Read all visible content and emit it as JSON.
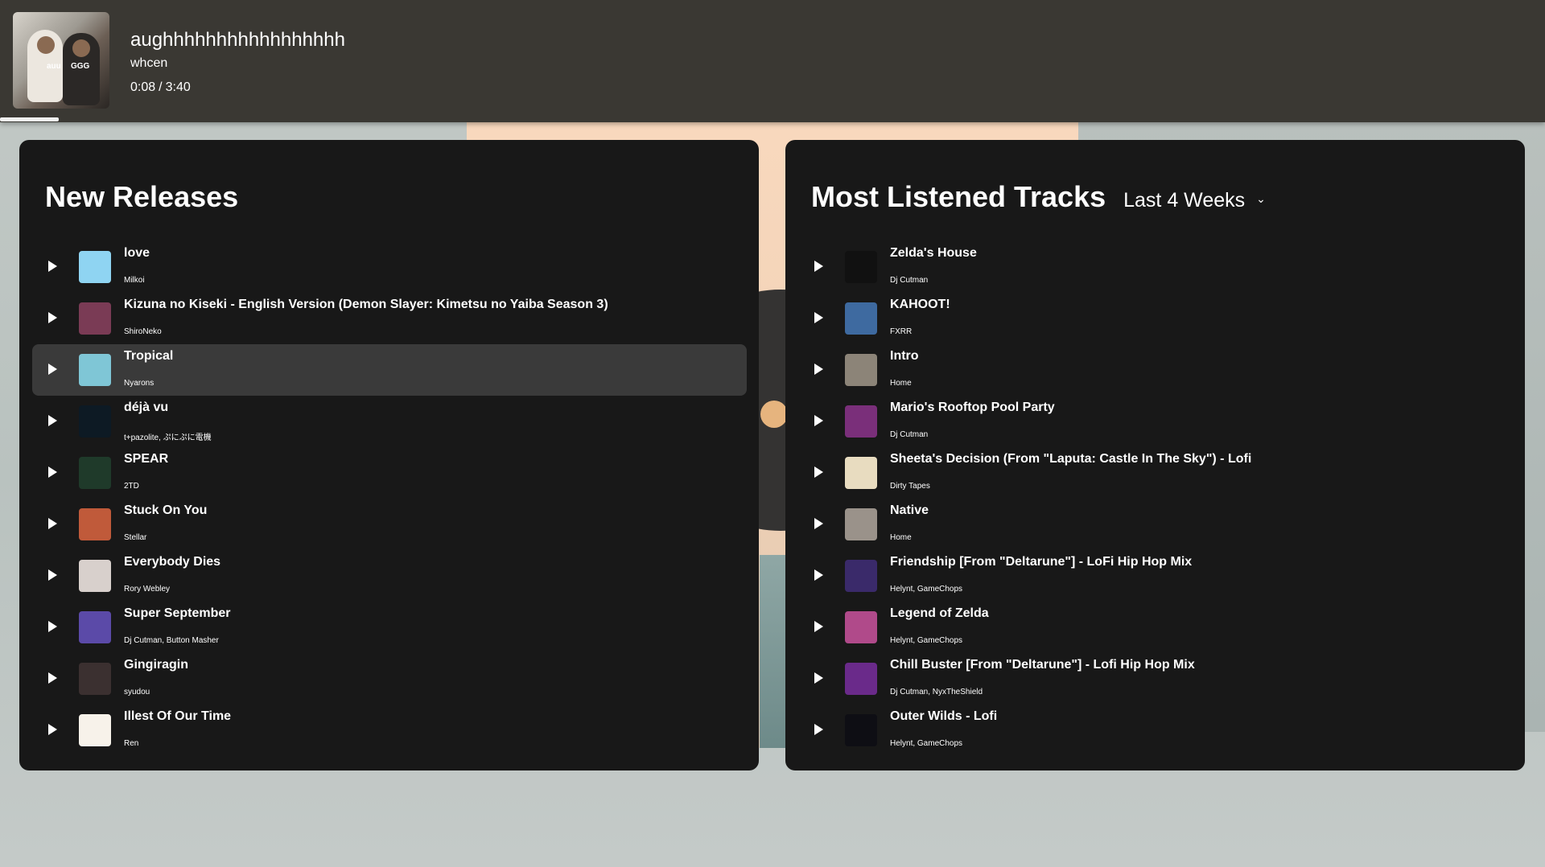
{
  "now_playing": {
    "title": "aughhhhhhhhhhhhhhhhh",
    "artist": "whcen",
    "elapsed": "0:08",
    "duration": "3:40",
    "progress": 0.038,
    "cover_text_left": "auu",
    "cover_text_right": "GGG"
  },
  "new_releases": {
    "title": "New Releases",
    "tracks": [
      {
        "name": "love",
        "artist": "Milkoi",
        "art_color": "#8fd4f2"
      },
      {
        "name": "Kizuna no Kiseki - English Version (Demon Slayer: Kimetsu no Yaiba Season 3)",
        "artist": "ShiroNeko",
        "art_color": "#7a3b55"
      },
      {
        "name": "Tropical",
        "artist": "Nyarons",
        "art_color": "#7fc6d6"
      },
      {
        "name": "déjà vu",
        "artist": "t+pazolite, ぷにぷに電機",
        "art_color": "#0d1a24"
      },
      {
        "name": "SPEAR",
        "artist": "2TD",
        "art_color": "#1f3a2a"
      },
      {
        "name": "Stuck On You",
        "artist": "Stellar",
        "art_color": "#c05a3a"
      },
      {
        "name": "Everybody Dies",
        "artist": "Rory Webley",
        "art_color": "#d8d0cc"
      },
      {
        "name": "Super September",
        "artist": "Dj Cutman, Button Masher",
        "art_color": "#5b4aa8"
      },
      {
        "name": "Gingiragin",
        "artist": "syudou",
        "art_color": "#3b3030"
      },
      {
        "name": "Illest Of Our Time",
        "artist": "Ren",
        "art_color": "#f7f2ea"
      }
    ]
  },
  "most_listened": {
    "title": "Most Listened Tracks",
    "range_label": "Last 4 Weeks",
    "tracks": [
      {
        "name": "Zelda's House",
        "artist": "Dj Cutman",
        "art_color": "#111111"
      },
      {
        "name": "KAHOOT!",
        "artist": "FXRR",
        "art_color": "#3e6aa0"
      },
      {
        "name": "Intro",
        "artist": "Home",
        "art_color": "#8c8478"
      },
      {
        "name": "Mario's Rooftop Pool Party",
        "artist": "Dj Cutman",
        "art_color": "#7a2f7a"
      },
      {
        "name": "Sheeta's Decision (From \"Laputa: Castle In The Sky\") - Lofi",
        "artist": "Dirty Tapes",
        "art_color": "#e8dcc0"
      },
      {
        "name": "Native",
        "artist": "Home",
        "art_color": "#9a928a"
      },
      {
        "name": "Friendship [From \"Deltarune\"] - LoFi Hip Hop Mix",
        "artist": "Helynt, GameChops",
        "art_color": "#3a2a6a"
      },
      {
        "name": "Legend of Zelda",
        "artist": "Helynt, GameChops",
        "art_color": "#b04a8a"
      },
      {
        "name": "Chill Buster [From \"Deltarune\"] - Lofi Hip Hop Mix",
        "artist": "Dj Cutman, NyxTheShield",
        "art_color": "#6a2a8a"
      },
      {
        "name": "Outer Wilds - Lofi",
        "artist": "Helynt, GameChops",
        "art_color": "#0e0e14"
      }
    ]
  },
  "active_row_index": 2,
  "icons": {
    "play": "play-icon",
    "chevron": "chevron-down-icon"
  }
}
